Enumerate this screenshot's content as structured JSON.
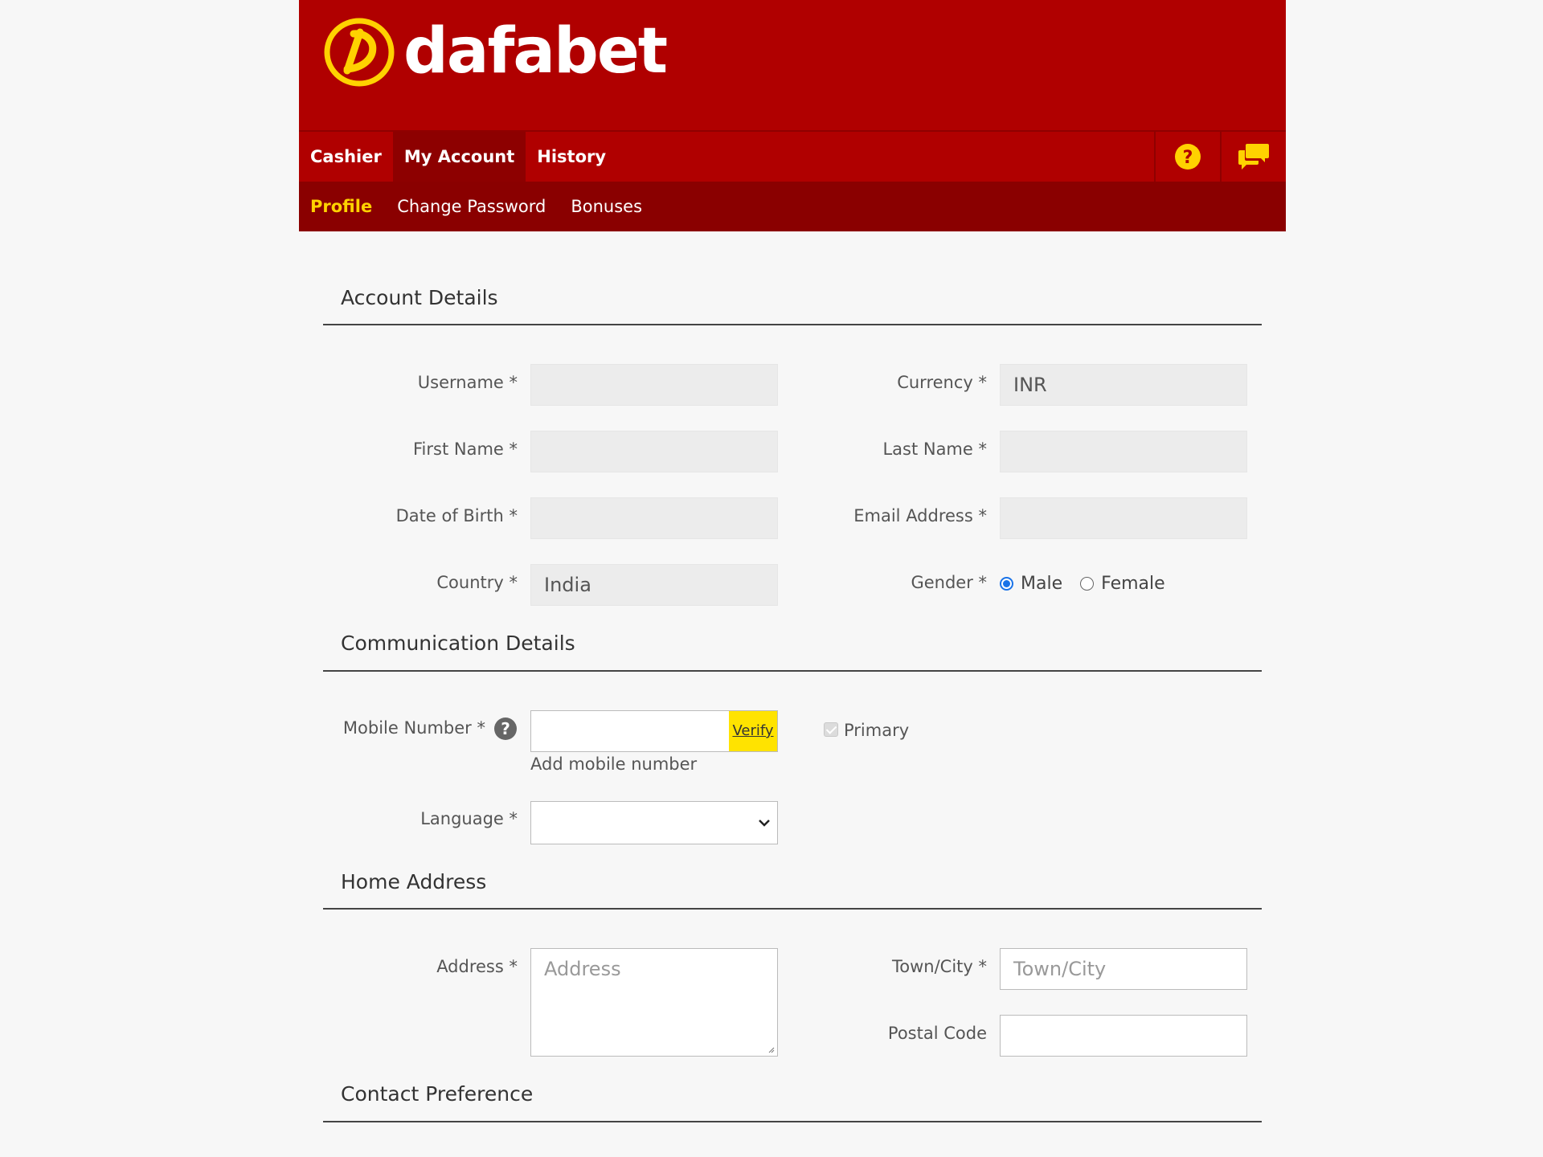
{
  "brand": {
    "name": "dafabet",
    "colors": {
      "primary": "#b00000",
      "subnav": "#8a0000",
      "accent": "#ffd200",
      "verify": "#ffe300"
    }
  },
  "mainnav": {
    "tabs": [
      {
        "label": "Cashier",
        "active": false
      },
      {
        "label": "My Account",
        "active": true
      },
      {
        "label": "History",
        "active": false
      }
    ],
    "icons": [
      "help-icon",
      "chat-icon"
    ]
  },
  "subnav": {
    "tabs": [
      {
        "label": "Profile",
        "active": true
      },
      {
        "label": "Change Password",
        "active": false
      },
      {
        "label": "Bonuses",
        "active": false
      }
    ]
  },
  "sections": {
    "account": "Account Details",
    "communication": "Communication Details",
    "home": "Home Address",
    "contact": "Contact Preference"
  },
  "account": {
    "username": {
      "label": "Username *",
      "value": ""
    },
    "currency": {
      "label": "Currency *",
      "value": "INR"
    },
    "first_name": {
      "label": "First Name *",
      "value": ""
    },
    "last_name": {
      "label": "Last Name *",
      "value": ""
    },
    "dob": {
      "label": "Date of Birth *",
      "value": ""
    },
    "email": {
      "label": "Email Address *",
      "value": ""
    },
    "country": {
      "label": "Country *",
      "value": "India"
    },
    "gender": {
      "label": "Gender *",
      "options": [
        "Male",
        "Female"
      ],
      "selected": "Male"
    }
  },
  "communication": {
    "mobile": {
      "label": "Mobile Number *",
      "value": "",
      "verify_label": "Verify",
      "hint": "Add mobile number",
      "help": "?"
    },
    "primary": {
      "label": "Primary",
      "checked": true
    },
    "language": {
      "label": "Language *",
      "value": ""
    }
  },
  "home": {
    "address": {
      "label": "Address *",
      "placeholder": "Address"
    },
    "town": {
      "label": "Town/City *",
      "placeholder": "Town/City"
    },
    "postal": {
      "label": "Postal Code",
      "value": ""
    }
  }
}
